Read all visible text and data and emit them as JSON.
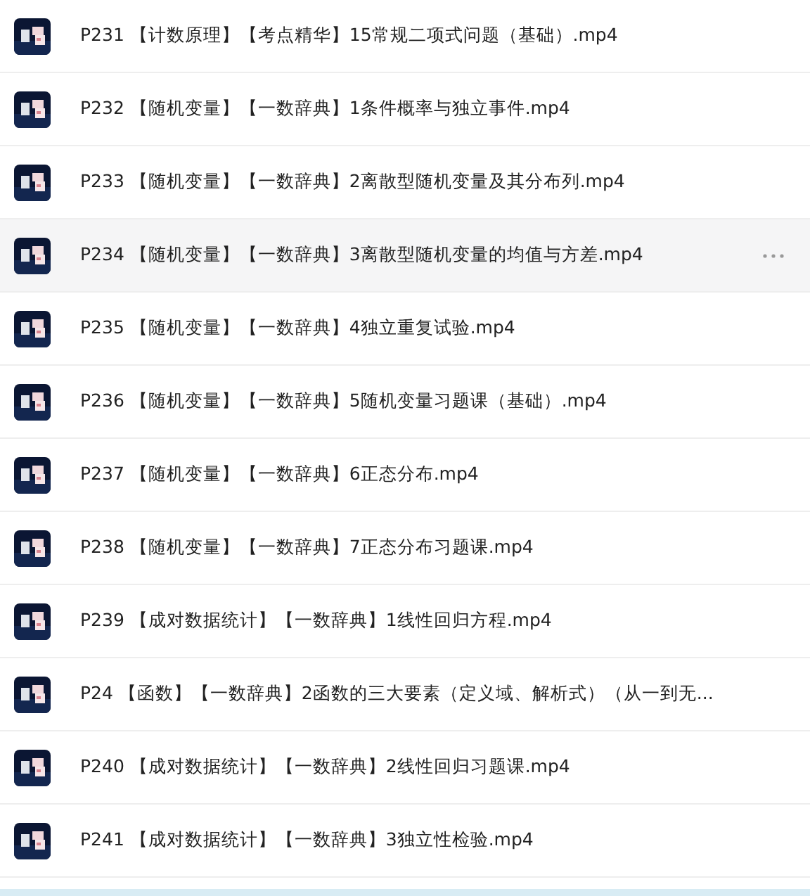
{
  "files": [
    {
      "name": "P231 【计数原理】【考点精华】15常规二项式问题（基础）.mp4",
      "hovered": false
    },
    {
      "name": "P232 【随机变量】【一数辞典】1条件概率与独立事件.mp4",
      "hovered": false
    },
    {
      "name": "P233 【随机变量】【一数辞典】2离散型随机变量及其分布列.mp4",
      "hovered": false
    },
    {
      "name": "P234 【随机变量】【一数辞典】3离散型随机变量的均值与方差.mp4",
      "hovered": true
    },
    {
      "name": "P235 【随机变量】【一数辞典】4独立重复试验.mp4",
      "hovered": false
    },
    {
      "name": "P236 【随机变量】【一数辞典】5随机变量习题课（基础）.mp4",
      "hovered": false
    },
    {
      "name": "P237 【随机变量】【一数辞典】6正态分布.mp4",
      "hovered": false
    },
    {
      "name": "P238 【随机变量】【一数辞典】7正态分布习题课.mp4",
      "hovered": false
    },
    {
      "name": "P239 【成对数据统计】【一数辞典】1线性回归方程.mp4",
      "hovered": false
    },
    {
      "name": "P24 【函数】【一数辞典】2函数的三大要素（定义域、解析式）（从一到无...",
      "hovered": false
    },
    {
      "name": "P240 【成对数据统计】【一数辞典】2线性回归习题课.mp4",
      "hovered": false
    },
    {
      "name": "P241 【成对数据统计】【一数辞典】3独立性检验.mp4",
      "hovered": false
    }
  ]
}
